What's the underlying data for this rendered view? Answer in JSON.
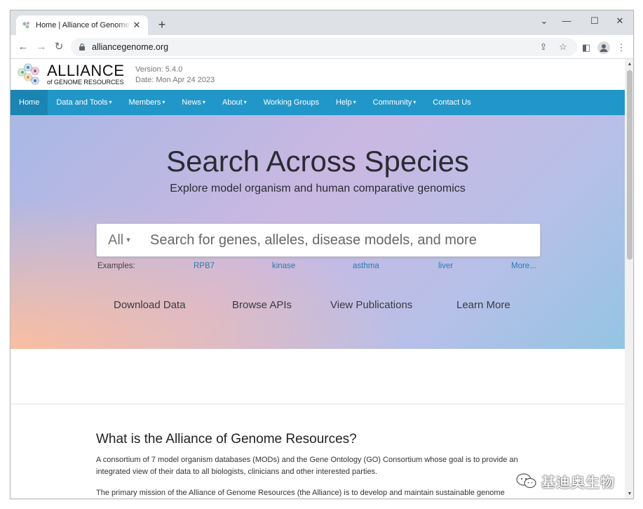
{
  "browser": {
    "tab_title": "Home | Alliance of Genome Resources",
    "new_tab": "+",
    "close": "✕",
    "url": "alliancegenome.org"
  },
  "header": {
    "logo_main": "ALLIANCE",
    "logo_sub": "of GENOME RESOURCES",
    "version": "Version: 5.4.0",
    "date": "Date: Mon Apr 24 2023"
  },
  "nav": {
    "items": [
      {
        "label": "Home",
        "dropdown": false
      },
      {
        "label": "Data and Tools",
        "dropdown": true
      },
      {
        "label": "Members",
        "dropdown": true
      },
      {
        "label": "News",
        "dropdown": true
      },
      {
        "label": "About",
        "dropdown": true
      },
      {
        "label": "Working Groups",
        "dropdown": false
      },
      {
        "label": "Help",
        "dropdown": true
      },
      {
        "label": "Community",
        "dropdown": true
      },
      {
        "label": "Contact Us",
        "dropdown": false
      }
    ],
    "caret": "▾"
  },
  "hero": {
    "title": "Search Across Species",
    "subtitle": "Explore model organism and human comparative genomics",
    "search_category": "All",
    "search_placeholder": "Search for genes, alleles, disease models, and more",
    "examples_label": "Examples:",
    "examples": [
      "RPB7",
      "kinase",
      "asthma",
      "liver",
      "More..."
    ],
    "links": [
      "Download Data",
      "Browse APIs",
      "View Publications",
      "Learn More"
    ]
  },
  "about": {
    "title": "What is the Alliance of Genome Resources?",
    "paragraph1": "A consortium of 7 model organism databases (MODs) and the Gene Ontology (GO) Consortium whose goal is to provide an integrated view of their data to all biologists, clinicians and other interested parties.",
    "paragraph2": "The primary mission of the Alliance of Genome Resources (the Alliance) is to develop and maintain sustainable genome"
  },
  "watermark": {
    "text": "基迪奥生物"
  },
  "colors": {
    "navbar": "#2197c9",
    "link": "#2a7ab0"
  }
}
